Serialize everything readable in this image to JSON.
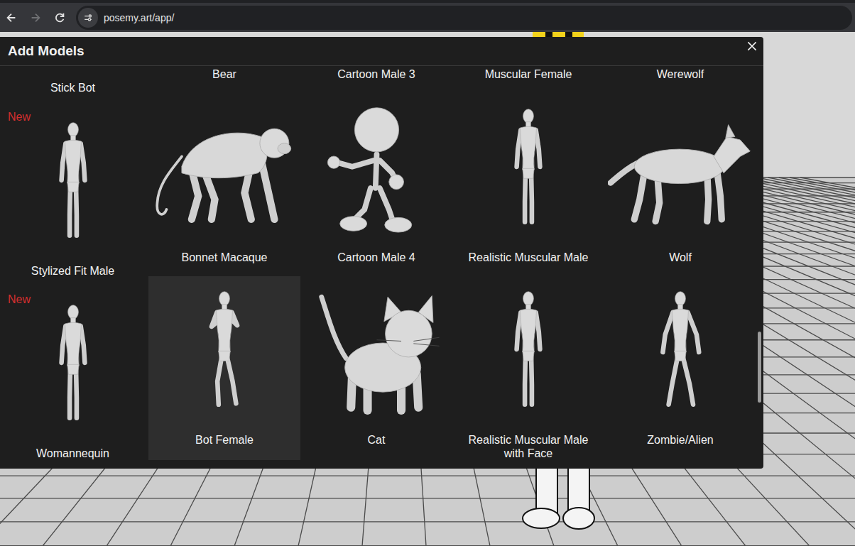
{
  "browser": {
    "url": "posemy.art/app/",
    "back_enabled": true,
    "forward_enabled": false
  },
  "modal": {
    "title": "Add Models",
    "new_badge": "New",
    "scrollbar": {
      "level": 0.8
    }
  },
  "rows": [
    {
      "cut_off": true,
      "items": [
        {
          "label": "Stick Bot",
          "new": false,
          "selected": false
        },
        {
          "label": "Bear",
          "new": false,
          "selected": false
        },
        {
          "label": "Cartoon Male 3",
          "new": false,
          "selected": false
        },
        {
          "label": "Muscular Female",
          "new": false,
          "selected": false
        },
        {
          "label": "Werewolf",
          "new": false,
          "selected": false
        }
      ]
    },
    {
      "cut_off": false,
      "items": [
        {
          "label": "Stylized Fit Male",
          "kind": "human",
          "new": true,
          "selected": false
        },
        {
          "label": "Bonnet Macaque",
          "kind": "monkey",
          "new": false,
          "selected": false
        },
        {
          "label": "Cartoon Male 4",
          "kind": "cartoon",
          "new": false,
          "selected": false
        },
        {
          "label": "Realistic Muscular Male",
          "kind": "human",
          "new": false,
          "selected": false
        },
        {
          "label": "Wolf",
          "kind": "wolf",
          "new": false,
          "selected": false
        }
      ]
    },
    {
      "cut_off": false,
      "items": [
        {
          "label": "Womannequin",
          "kind": "human",
          "new": true,
          "selected": false
        },
        {
          "label": "Bot Female",
          "kind": "bot",
          "new": false,
          "selected": true
        },
        {
          "label": "Cat",
          "kind": "cat",
          "new": false,
          "selected": false
        },
        {
          "label": "Realistic Muscular Male with Face",
          "kind": "human",
          "new": false,
          "selected": false
        },
        {
          "label": "Zombie/Alien",
          "kind": "zombie",
          "new": false,
          "selected": false
        }
      ]
    }
  ]
}
